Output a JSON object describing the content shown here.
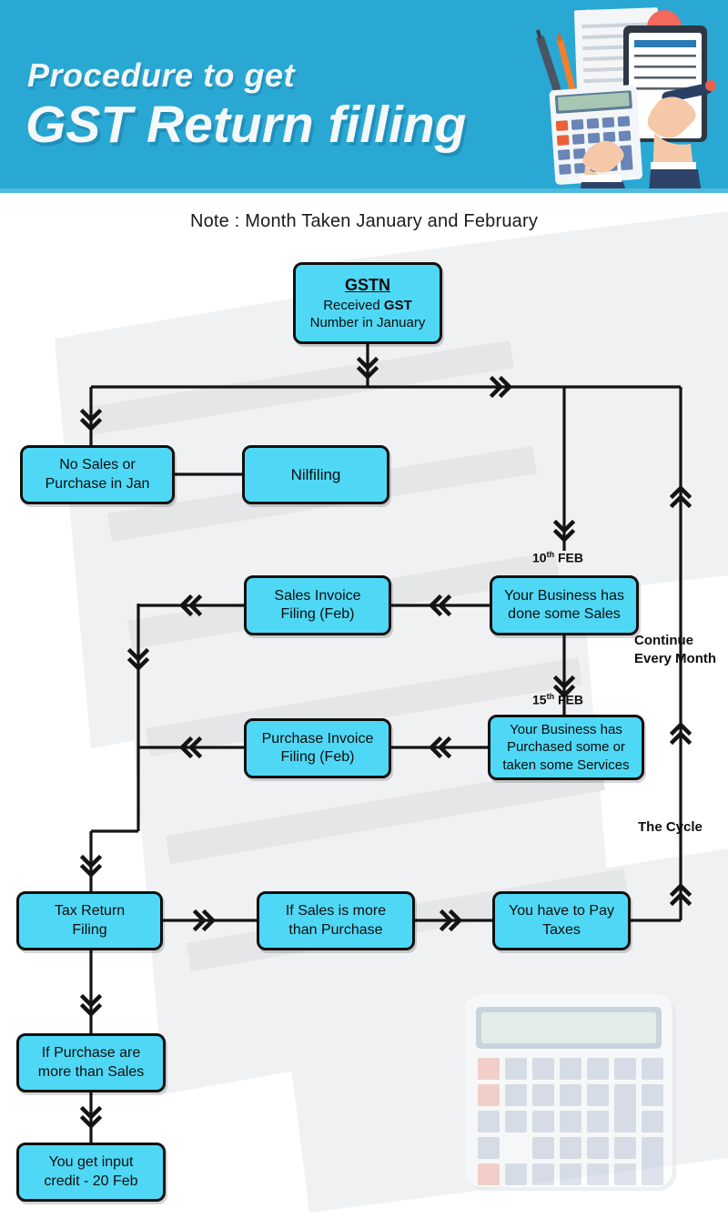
{
  "header": {
    "line1": "Procedure to get",
    "line2": "GST Return filling",
    "bg_color": "#29a8d4",
    "illustration": "desk-with-calculator-clipboard-and-papers"
  },
  "note": "Note : Month Taken January and February",
  "theme": {
    "node_fill": "#4fd8f5",
    "node_border": "#101010",
    "line_color": "#141414",
    "page_bg": "#ffffff"
  },
  "flow": {
    "nodes": [
      {
        "id": "gstn",
        "title": "GSTN",
        "line2_prefix": "Received ",
        "line2_bold": "GST",
        "line3": "Number in January"
      },
      {
        "id": "no-sales-or-purchase-in-jan",
        "label": "No Sales or\nPurchase in Jan"
      },
      {
        "id": "nilfiling",
        "label": "Nilfiling"
      },
      {
        "id": "your-business-has-done-some-sales",
        "label": "Your Business has\ndone some Sales"
      },
      {
        "id": "sales-invoice-filing-feb",
        "label": "Sales Invoice\nFiling (Feb)"
      },
      {
        "id": "your-business-has-purchased",
        "label": "Your Business has\nPurchased some or\ntaken some Services"
      },
      {
        "id": "purchase-invoice-filing-feb",
        "label": "Purchase Invoice\nFiling (Feb)"
      },
      {
        "id": "tax-return-filing",
        "label": "Tax Return\nFiling"
      },
      {
        "id": "if-sales-is-more-than-purchase",
        "label": "If Sales is more\nthan Purchase"
      },
      {
        "id": "you-have-to-pay-taxes",
        "label": "You have to Pay\nTaxes"
      },
      {
        "id": "if-purchase-are-more-than-sales",
        "label": "If Purchase are\nmore than Sales"
      },
      {
        "id": "you-get-input-credit",
        "label": "You get input\ncredit - 20 Feb"
      }
    ],
    "date_labels": [
      {
        "id": "feb-10",
        "day": "10",
        "ordinal": "th",
        "month": "FEB"
      },
      {
        "id": "feb-15",
        "day": "15",
        "ordinal": "th",
        "month": "FEB"
      }
    ],
    "side_labels": [
      {
        "id": "continue-every-month",
        "line1": "Continue",
        "line2": "Every Month"
      },
      {
        "id": "the-cycle",
        "line1": "The Cycle",
        "line2": ""
      }
    ]
  },
  "calculator_watermark": {
    "columns": 7,
    "rows": 5,
    "accent_color": "#f3b5a6",
    "key_color": "#c2ccdd",
    "display_color": "#dbe8e4",
    "frame_color": "#a8bccb"
  }
}
